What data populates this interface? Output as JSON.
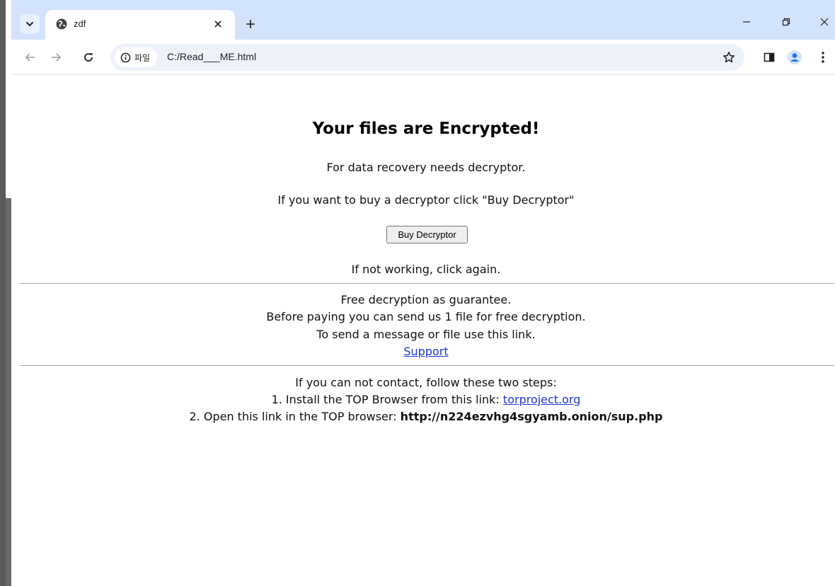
{
  "browser": {
    "tab": {
      "title": "zdf"
    },
    "omnibox": {
      "chip_label": "파일",
      "url": "C:/Read___ME.html"
    },
    "icons": {
      "tab_search": "chevron-down-icon",
      "favicon": "globe-icon",
      "tab_close": "close-icon",
      "new_tab": "plus-icon",
      "minimize": "minimize-icon",
      "restore": "restore-icon",
      "close_window": "close-icon",
      "back": "back-arrow-icon",
      "forward": "forward-arrow-icon",
      "reload": "reload-icon",
      "info": "info-icon",
      "bookmark": "star-icon",
      "side_panel": "side-panel-icon",
      "profile": "profile-icon",
      "menu": "kebab-menu-icon"
    },
    "colors": {
      "tabstrip": "#d3e3fd",
      "omnibox": "#edf2fa",
      "profile": "#1a73e8"
    }
  },
  "page": {
    "heading": "Your files are Encrypted!",
    "line1": "For data recovery needs decryptor.",
    "line2": "If you want to buy a decryptor click \"Buy Decryptor\"",
    "buy_button": "Buy Decryptor",
    "line3": "If not working, click again.",
    "guarantee": {
      "l1": "Free decryption as guarantee.",
      "l2": "Before paying you can send us 1 file for free decryption.",
      "l3": "To send a message or file use this link.",
      "link": "Support"
    },
    "steps": {
      "intro": "If you can not contact, follow these two steps:",
      "step1_text": "1. Install the TOP Browser from this link: ",
      "step1_link": "torproject.org",
      "step2_text": "2. Open this link in the TOP browser: ",
      "step2_url": "http://n224ezvhg4sgyamb.onion/sup.php"
    }
  }
}
